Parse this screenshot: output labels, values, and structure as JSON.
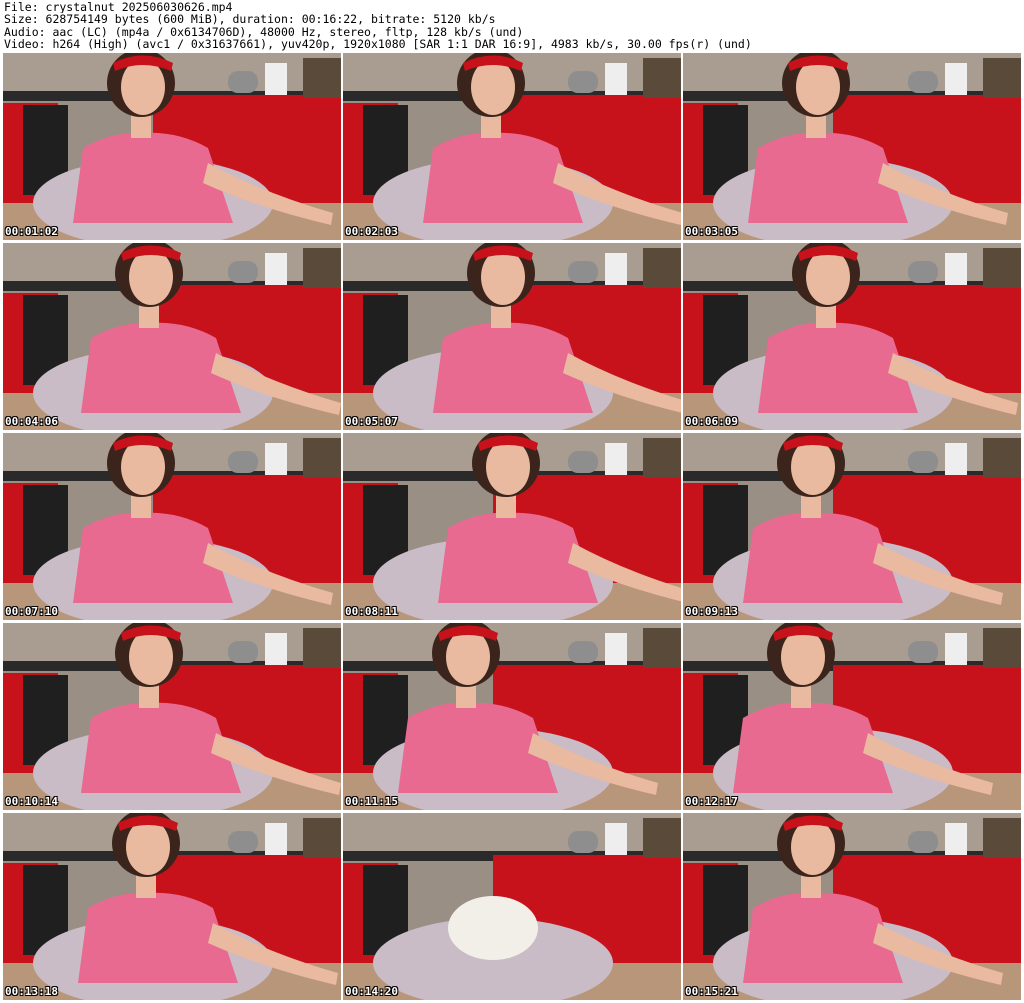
{
  "header": {
    "lines": [
      "File: crystalnut_202506030626.mp4",
      "Size: 628754149 bytes (600 MiB), duration: 00:16:22, bitrate: 5120 kb/s",
      "Audio: aac (LC) (mp4a / 0x6134706D), 48000 Hz, stereo, fltp, 128 kb/s (und)",
      "Video: h264 (High) (avc1 / 0x31637661), yuv420p, 1920x1080 [SAR 1:1 DAR 16:9], 4983 kb/s, 30.00 fps(r) (und)"
    ]
  },
  "colors": {
    "cabinet_red": "#c8121b",
    "countertop": "#2a2a2a",
    "wall_tile": "#9a8f84",
    "shirt_pink": "#e86a90",
    "skin": "#e9b9a0",
    "hair": "#3a241b",
    "chair": "#c9bcc6",
    "floor": "#b7967a"
  },
  "thumbnails": [
    {
      "timestamp": "00:01:02"
    },
    {
      "timestamp": "00:02:03"
    },
    {
      "timestamp": "00:03:05"
    },
    {
      "timestamp": "00:04:06"
    },
    {
      "timestamp": "00:05:07"
    },
    {
      "timestamp": "00:06:09"
    },
    {
      "timestamp": "00:07:10"
    },
    {
      "timestamp": "00:08:11"
    },
    {
      "timestamp": "00:09:13"
    },
    {
      "timestamp": "00:10:14"
    },
    {
      "timestamp": "00:11:15"
    },
    {
      "timestamp": "00:12:17"
    },
    {
      "timestamp": "00:13:18"
    },
    {
      "timestamp": "00:14:20"
    },
    {
      "timestamp": "00:15:21"
    }
  ]
}
